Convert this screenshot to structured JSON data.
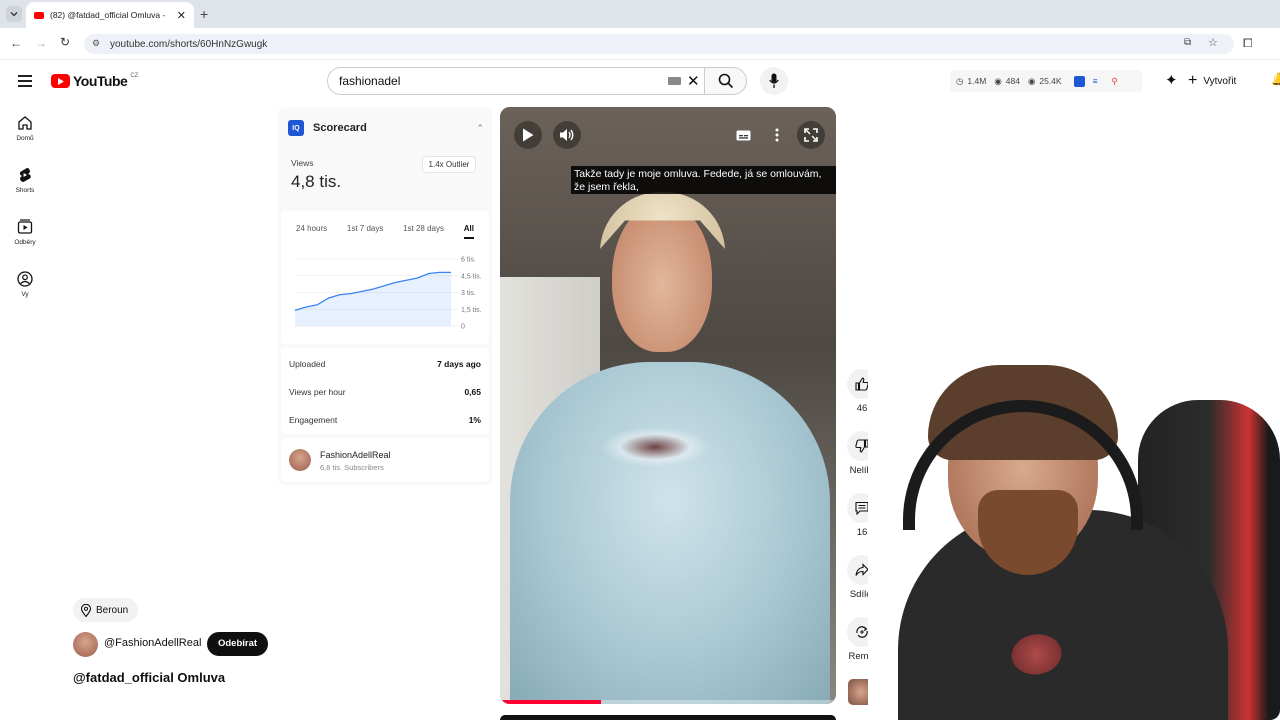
{
  "browser": {
    "tab_title": "(82) @fatdad_official Omluva -",
    "url": "youtube.com/shorts/60HnNzGwugk"
  },
  "youtube": {
    "logo_text": "YouTube",
    "region": "CZ",
    "search_value": "fashionadel",
    "create_label": "Vytvořit",
    "stats": {
      "subs": "1.4M",
      "views": "484",
      "watch": "25.4K"
    },
    "sidebar": [
      {
        "label": "Domů",
        "icon": "home-icon"
      },
      {
        "label": "Shorts",
        "icon": "shorts-icon"
      },
      {
        "label": "Odběry",
        "icon": "subscriptions-icon"
      },
      {
        "label": "Vy",
        "icon": "you-icon"
      }
    ]
  },
  "scorecard": {
    "title": "Scorecard",
    "views_label": "Views",
    "views_value": "4,8 tis.",
    "outlier": "1.4x Outlier",
    "tabs": [
      "24 hours",
      "1st 7 days",
      "1st 28 days",
      "All"
    ],
    "active_tab": "All",
    "y_ticks": [
      "6 tis.",
      "4,5 tis.",
      "3 tis.",
      "1,5 tis.",
      "0"
    ],
    "rows": [
      {
        "label": "Uploaded",
        "value": "7 days ago"
      },
      {
        "label": "Views per hour",
        "value": "0,65"
      },
      {
        "label": "Engagement",
        "value": "1%"
      }
    ],
    "channel_name": "FashionAdellReal",
    "channel_subs": "6,8 tis. Subscribers"
  },
  "chart_data": {
    "type": "area",
    "y_ticks": [
      "6 tis.",
      "4,5 tis.",
      "3 tis.",
      "1,5 tis.",
      "0"
    ],
    "ylim": [
      0,
      6000
    ],
    "values": [
      1400,
      1700,
      1900,
      2500,
      2800,
      2900,
      3100,
      3300,
      3600,
      3900,
      4100,
      4300,
      4700,
      4800,
      4800
    ],
    "color": "#3b82f6"
  },
  "video": {
    "caption": "Takže tady je moje omluva. Fedede, já se omlouvám, že jsem řekla,",
    "progress": 0.3
  },
  "actions": [
    {
      "label": "46",
      "icon": "like-icon"
    },
    {
      "label": "Nelíbí",
      "icon": "dislike-icon"
    },
    {
      "label": "16",
      "icon": "comment-icon"
    },
    {
      "label": "Sdílet",
      "icon": "share-icon"
    },
    {
      "label": "Remix",
      "icon": "remix-icon"
    }
  ],
  "short_info": {
    "location": "Beroun",
    "channel": "@FashionAdellReal",
    "subscribe": "Odebírat",
    "title": "@fatdad_official Omluva"
  }
}
